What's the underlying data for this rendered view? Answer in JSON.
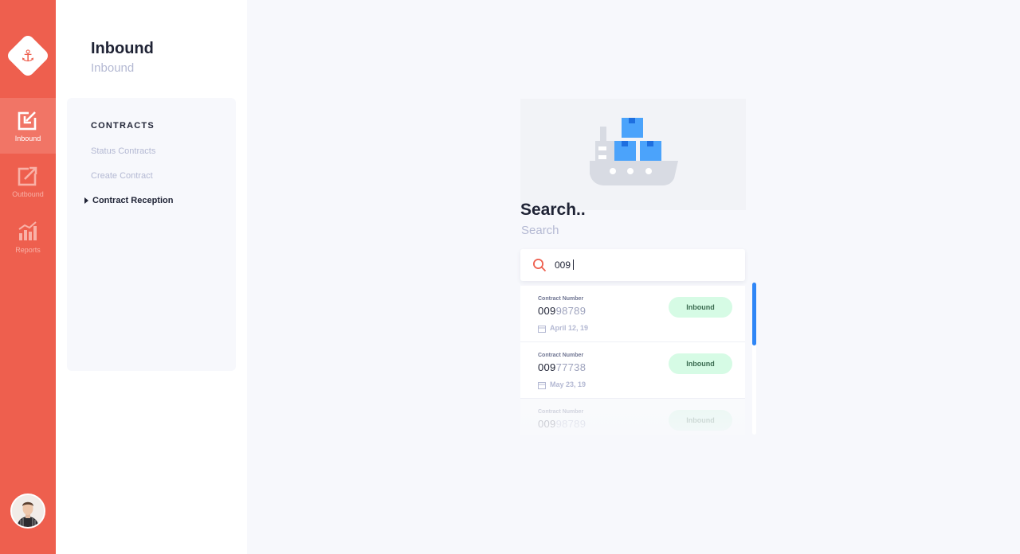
{
  "rail": {
    "logo_icon": "anchor-icon",
    "items": [
      {
        "label": "Inbound",
        "icon": "inbound-icon",
        "active": true
      },
      {
        "label": "Outbound",
        "icon": "outbound-icon",
        "active": false
      },
      {
        "label": "Reports",
        "icon": "reports-icon",
        "active": false
      }
    ],
    "avatar_icon": "user-avatar"
  },
  "header": {
    "title": "Inbound",
    "subtitle": "Inbound"
  },
  "menu": {
    "heading": "CONTRACTS",
    "items": [
      {
        "label": "Status Contracts",
        "active": false
      },
      {
        "label": "Create Contract",
        "active": false
      },
      {
        "label": "Contract Reception",
        "active": true
      }
    ]
  },
  "search": {
    "title": "Search..",
    "subtitle": "Search",
    "query": "009",
    "icon": "search-icon"
  },
  "results": [
    {
      "label": "Contract Number",
      "number_match": "009",
      "number_rest": "98789",
      "date": "April 12, 19",
      "status": "Inbound"
    },
    {
      "label": "Contract Number",
      "number_match": "009",
      "number_rest": "77738",
      "date": "May 23, 19",
      "status": "Inbound"
    },
    {
      "label": "Contract Number",
      "number_match": "009",
      "number_rest": "98789",
      "status": "Inbound"
    }
  ],
  "colors": {
    "brand": "#ee5f4e",
    "accent_blue": "#2f86f6",
    "badge_bg": "#d6fbe5",
    "text_dark": "#1f2335",
    "text_muted": "#b4b9d3"
  }
}
